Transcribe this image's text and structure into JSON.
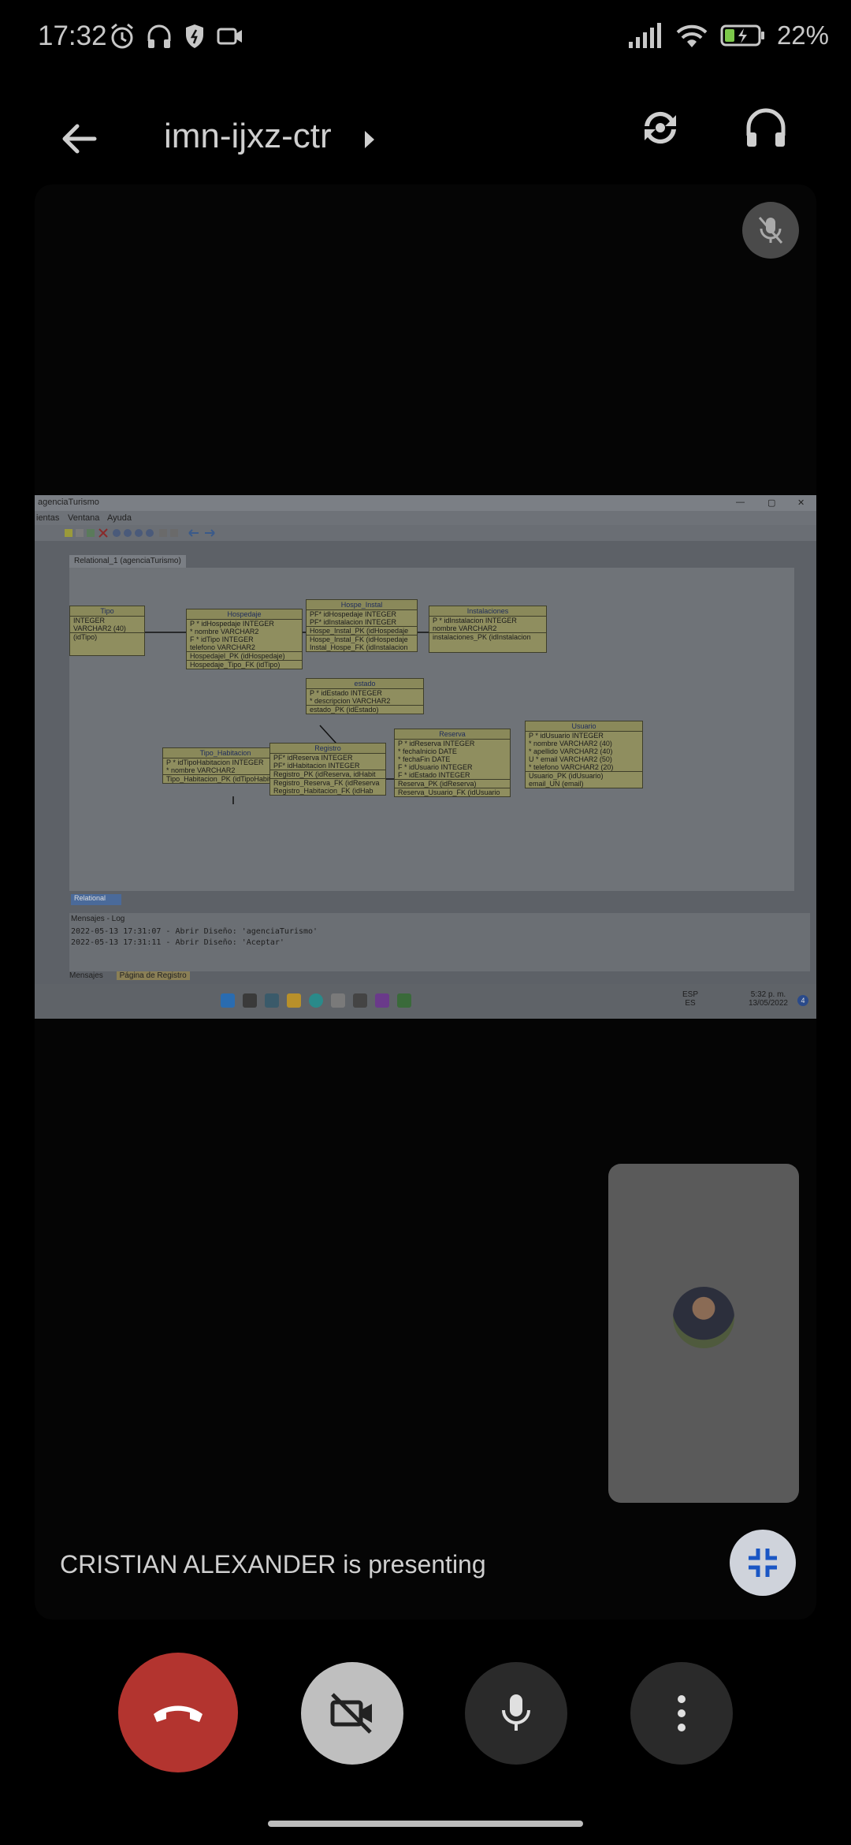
{
  "status_bar": {
    "time": "17:32",
    "battery": "22%",
    "icons": [
      "alarm-icon",
      "headphones-icon",
      "shield-icon",
      "video-icon",
      "signal-icon",
      "wifi-icon",
      "battery-charging-icon"
    ]
  },
  "header": {
    "meeting_code": "imn-ijxz-ctr"
  },
  "shared_screen": {
    "window_title": "agenciaTurismo",
    "menu": [
      "ientas",
      "Ventana",
      "Ayuda"
    ],
    "tab": "Relational_1 (agenciaTurismo)",
    "tables": {
      "tipo": {
        "title": "Tipo",
        "rows": [
          "INTEGER",
          "VARCHAR2 (40)"
        ],
        "keys": [
          "(idTipo)"
        ]
      },
      "hospedaje": {
        "title": "Hospedaje",
        "rows": [
          "P * idHospedaje   INTEGER",
          "* nombre   VARCHAR2",
          "F * idTipo   INTEGER",
          "telefono   VARCHAR2"
        ],
        "keys": [
          "Hospedajel_PK (idHospedaje)",
          "Hospedaje_Tipo_FK (idTipo)"
        ]
      },
      "hospe_instal": {
        "title": "Hospe_Instal",
        "rows": [
          "PF* idHospedaje   INTEGER",
          "PF* idInstalacion   INTEGER"
        ],
        "keys": [
          "Hospe_Instal_PK (idHospedaje",
          "Hospe_Instal_FK (idHospedaje",
          "Instal_Hospe_FK (idInstalacion"
        ]
      },
      "instalaciones": {
        "title": "Instalaciones",
        "rows": [
          "P * idInstalacion   INTEGER",
          "nombre   VARCHAR2"
        ],
        "keys": [
          "instalaciones_PK (idInstalacion"
        ]
      },
      "estado": {
        "title": "estado",
        "rows": [
          "P * idEstado   INTEGER",
          "* descripcion   VARCHAR2"
        ],
        "keys": [
          "estado_PK (idEstado)"
        ]
      },
      "tipo_habitacion": {
        "title": "Tipo_Habitacion",
        "rows": [
          "P * idTipoHabitacion   INTEGER",
          "* nombre   VARCHAR2"
        ],
        "keys": [
          "Tipo_Habitacion_PK (idTipoHabit"
        ]
      },
      "registro": {
        "title": "Registro",
        "rows": [
          "PF* idReserva   INTEGER",
          "PF* idHabitacion   INTEGER"
        ],
        "keys": [
          "Registro_PK (idReserva, idHabit",
          "Registro_Reserva_FK (idReserva",
          "Registro_Habitacion_FK (idHab"
        ]
      },
      "reserva": {
        "title": "Reserva",
        "rows": [
          "P * idReserva   INTEGER",
          "* fechaInicio   DATE",
          "* fechaFin   DATE",
          "F * idUsuario   INTEGER",
          "F * idEstado   INTEGER"
        ],
        "keys": [
          "Reserva_PK (idReserva)",
          "Reserva_Usuario_FK (idUsuario"
        ]
      },
      "usuario": {
        "title": "Usuario",
        "rows": [
          "P * idUsuario   INTEGER",
          "* nombre   VARCHAR2 (40)",
          "* apellido   VARCHAR2 (40)",
          "U * email   VARCHAR2 (50)",
          "* telefono   VARCHAR2 (20)"
        ],
        "keys": [
          "Usuario_PK (idUsuario)",
          "email_UN (email)"
        ]
      }
    },
    "log_title": "Mensajes - Log",
    "log_lines": [
      "2022-05-13 17:31:07 - Abrir Diseño: 'agenciaTurismo'",
      "2022-05-13 17:31:11 - Abrir Diseño: 'Aceptar'"
    ],
    "bottom_tabs": [
      "Mensajes",
      "Página de Registro"
    ],
    "relational_tab": "Relational",
    "taskbar_lang": [
      "ESP",
      "ES"
    ],
    "taskbar_time": "5:32 p. m.",
    "taskbar_date": "13/05/2022",
    "notification_count": "4"
  },
  "presenter_text": "CRISTIAN ALEXANDER is presenting",
  "colors": {
    "hangup": "#b3342f",
    "camera_off": "#bfbfbf",
    "control_dark": "#2a2a2a"
  }
}
